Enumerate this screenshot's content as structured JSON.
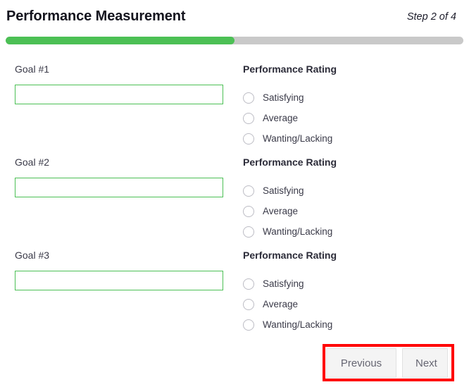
{
  "header": {
    "title": "Performance Measurement",
    "step_indicator": "Step 2 of 4"
  },
  "progress": {
    "percent": 50,
    "fill_color": "#4cc055",
    "track_color": "#c9c9c9"
  },
  "form": {
    "goals": [
      {
        "label": "Goal #1",
        "value": "",
        "placeholder": ""
      },
      {
        "label": "Goal #2",
        "value": "",
        "placeholder": ""
      },
      {
        "label": "Goal #3",
        "value": "",
        "placeholder": ""
      }
    ],
    "ratings": [
      {
        "title": "Performance Rating",
        "options": [
          {
            "label": "Satisfying",
            "selected": false
          },
          {
            "label": "Average",
            "selected": false
          },
          {
            "label": "Wanting/Lacking",
            "selected": false
          }
        ]
      },
      {
        "title": "Performance Rating",
        "options": [
          {
            "label": "Satisfying",
            "selected": false
          },
          {
            "label": "Average",
            "selected": false
          },
          {
            "label": "Wanting/Lacking",
            "selected": false
          }
        ]
      },
      {
        "title": "Performance Rating",
        "options": [
          {
            "label": "Satisfying",
            "selected": false
          },
          {
            "label": "Average",
            "selected": false
          },
          {
            "label": "Wanting/Lacking",
            "selected": false
          }
        ]
      }
    ]
  },
  "footer": {
    "previous_label": "Previous",
    "next_label": "Next"
  },
  "annotation": {
    "color": "#ff0000"
  },
  "colors": {
    "accent_green": "#4cc055",
    "input_border": "#4cc055",
    "button_bg": "#f4f4f4",
    "text_dark": "#14141e"
  }
}
